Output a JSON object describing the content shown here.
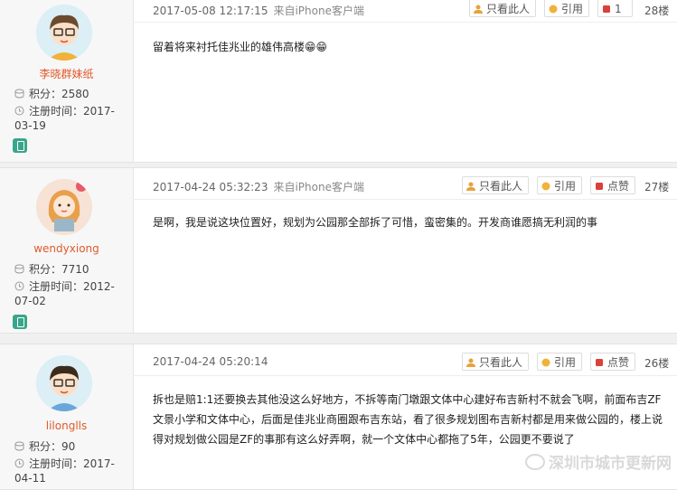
{
  "buttons": {
    "only_this_user": "只看此人",
    "quote": "引用",
    "like": "点赞"
  },
  "posts": [
    {
      "username": "李晓群妹纸",
      "points_label": "积分：2580",
      "reg_label": "注册时间：2017-03-19",
      "datetime": "2017-05-08 12:17:15",
      "source": "来自iPhone客户端",
      "like_count": "1",
      "floor": "28楼",
      "content": "留着将来衬托佳兆业的雄伟高楼😁😁"
    },
    {
      "username": "wendyxiong",
      "points_label": "积分：7710",
      "reg_label": "注册时间：2012-07-02",
      "datetime": "2017-04-24 05:32:23",
      "source": "来自iPhone客户端",
      "floor": "27楼",
      "content": "是啊，我是说这块位置好，规划为公园那全部拆了可惜，蛮密集的。开发商谁愿搞无利润的事"
    },
    {
      "username": "lilonglls",
      "points_label": "积分：90",
      "reg_label": "注册时间：2017-04-11",
      "datetime": "2017-04-24 05:20:14",
      "floor": "26楼",
      "content": "拆也是赔1:1还要换去其他没这么好地方，不拆等南门墩跟文体中心建好布吉新村不就会飞啊，前面布吉ZF文景小学和文体中心，后面是佳兆业商圈跟布吉东站，看了很多规划图布吉新村都是用来做公园的，楼上说得对规划做公园是ZF的事那有这么好弄啊，就一个文体中心都拖了5年，公园更不要说了"
    }
  ],
  "watermark": "深圳市城市更新网"
}
